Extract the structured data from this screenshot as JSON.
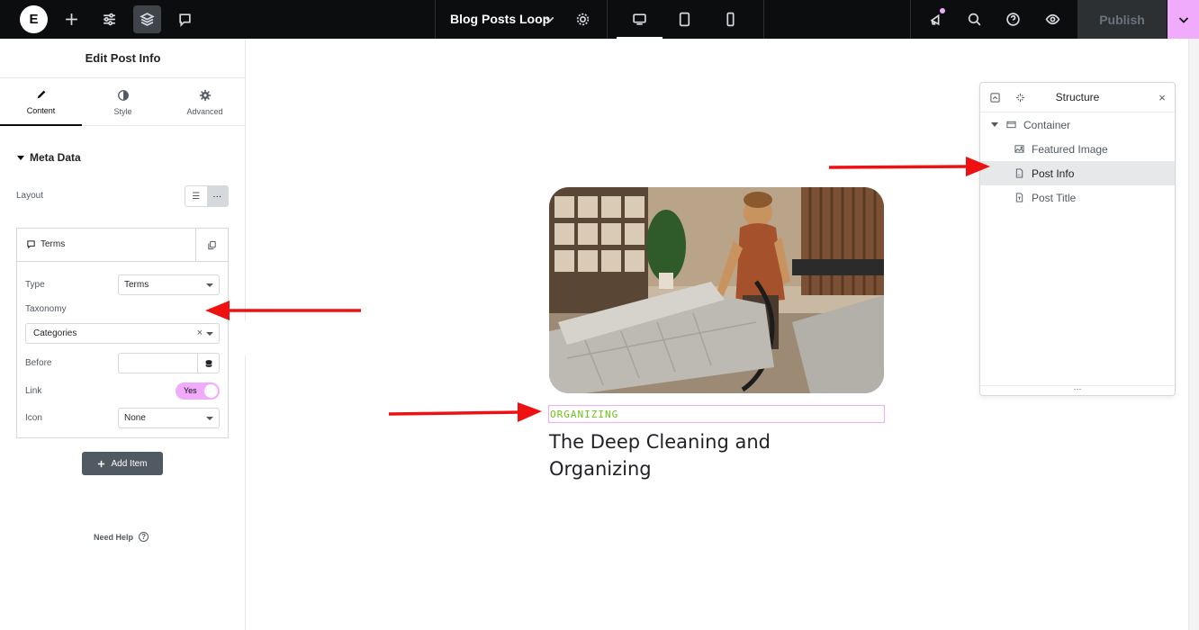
{
  "topbar": {
    "logo_letter": "E",
    "document_title": "Blog Posts Loop",
    "publish_label": "Publish",
    "icons": [
      "add-icon",
      "settings-sliders-icon",
      "layers-icon",
      "comment-icon",
      "gear-icon",
      "desktop-icon",
      "tablet-icon",
      "mobile-icon",
      "whats-new-icon",
      "search-icon",
      "help-icon",
      "preview-eye-icon",
      "chevron-down-icon"
    ],
    "accent": "#f0abfc"
  },
  "panel": {
    "title": "Edit Post Info",
    "tabs": [
      {
        "label": "Content",
        "icon": "pencil-icon"
      },
      {
        "label": "Style",
        "icon": "half-circle-icon"
      },
      {
        "label": "Advanced",
        "icon": "gear-icon"
      }
    ],
    "section_title": "Meta Data",
    "layout_label": "Layout",
    "repeater_item_label": "Terms",
    "type_label": "Type",
    "type_value": "Terms",
    "taxonomy_label": "Taxonomy",
    "taxonomy_value": "Categories",
    "clear_glyph": "×",
    "before_label": "Before",
    "before_value": "",
    "link_label": "Link",
    "link_value": "Yes",
    "icon_label": "Icon",
    "icon_value": "None",
    "add_item_label": "Add Item",
    "need_help_label": "Need Help",
    "help_glyph": "?",
    "collapse_glyph": "‹",
    "list_glyph": "☰",
    "inline_glyph": "···"
  },
  "canvas": {
    "post_info_text": "ORGANIZING",
    "post_title": "The Deep Cleaning and Organizing",
    "post_info_color": "#6ec21d",
    "image_alt": "Woman vacuuming a grey sofa in a living room"
  },
  "structure": {
    "title": "Structure",
    "close_glyph": "×",
    "footer_glyph": "···",
    "items": [
      {
        "label": "Container",
        "icon": "container-icon"
      },
      {
        "label": "Featured Image",
        "icon": "image-icon"
      },
      {
        "label": "Post Info",
        "icon": "post-info-icon"
      },
      {
        "label": "Post Title",
        "icon": "post-title-icon"
      }
    ]
  },
  "annotations": {
    "arrow_color": "#ee1111"
  }
}
